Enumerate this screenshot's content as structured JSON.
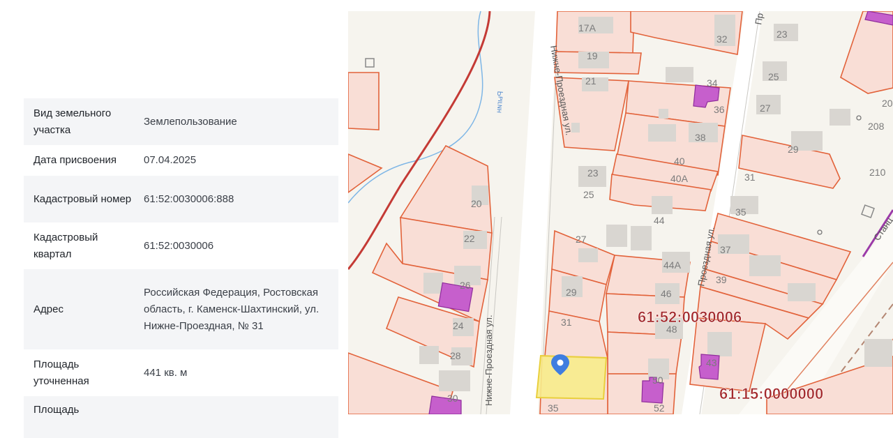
{
  "info": {
    "rows": [
      {
        "label": "Вид земельного участка",
        "value": "Землепользование"
      },
      {
        "label": "Дата присвоения",
        "value": "07.04.2025"
      },
      {
        "label": "Кадастровый номер",
        "value": "61:52:0030006:888"
      },
      {
        "label": "Кадастровый квартал",
        "value": "61:52:0030006"
      },
      {
        "label": "Адрес",
        "value": "Российская Федерация, Ростовская область, г. Каменск-Шахтинский, ул. Нижне-Проездная, № 31"
      },
      {
        "label": "Площадь уточненная",
        "value": "441 кв. м"
      },
      {
        "label": "Площадь",
        "value": ""
      }
    ]
  },
  "map": {
    "quarter_labels": [
      "61:52:0030006",
      "61:15:0000000"
    ],
    "street_labels": [
      "Нижне-Проездная ул.",
      "Нижне-Проездная ул.",
      "Проездная ул.",
      "Пр",
      "Станц",
      "Рыгин"
    ],
    "house_numbers": [
      "17А",
      "19",
      "21",
      "23",
      "25",
      "27",
      "29",
      "31",
      "35",
      "20",
      "22",
      "26",
      "24",
      "28",
      "30",
      "32",
      "34",
      "36",
      "38",
      "40",
      "40А",
      "44",
      "44А",
      "46",
      "48",
      "50",
      "52",
      "43",
      "23",
      "25",
      "27",
      "29",
      "31",
      "35",
      "37",
      "39",
      "208",
      "210",
      "20"
    ],
    "colors": {
      "parcel_stroke": "#e2623a",
      "parcel_fill": "#f9ded6",
      "building": "#d9d6d1",
      "selected_fill": "#f7ec8c",
      "selected_stroke": "#e9cf3c",
      "marker": "#3f7de0",
      "purple": "#c65fcc",
      "river": "#7eb6e6",
      "quarter_text": "#a3282b"
    },
    "marker_icon": "location-pin-icon"
  }
}
